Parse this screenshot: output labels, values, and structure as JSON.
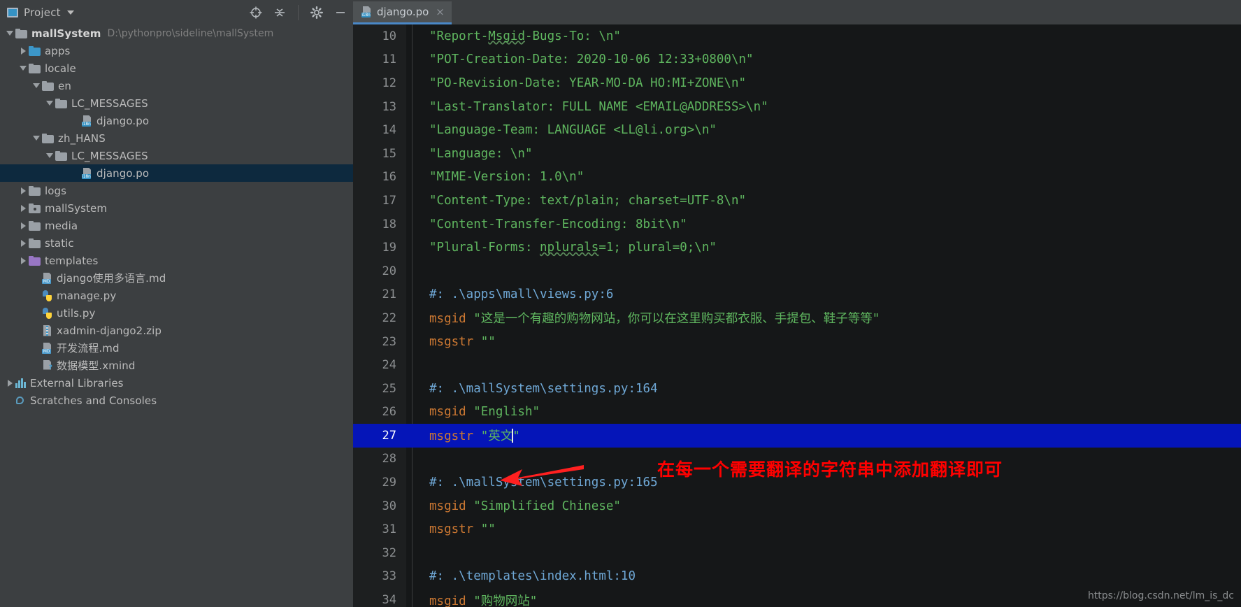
{
  "window": {
    "project_label": "Project",
    "toolbar_icons": [
      "target-icon",
      "collapse-all-icon",
      "gear-icon",
      "minimize-icon"
    ]
  },
  "tab": {
    "title": "django.po",
    "close_label": "×",
    "icon": "i18n-file-icon",
    "badge": "i18n"
  },
  "sidebar": {
    "items": [
      {
        "label": "mallSystem",
        "path": "D:\\pythonpro\\sideline\\mallSystem",
        "indent": 0,
        "arrow": "open",
        "icon": "folder",
        "bold": true
      },
      {
        "label": "apps",
        "path": "",
        "indent": 1,
        "arrow": "closed",
        "icon": "folder-blue",
        "bold": false
      },
      {
        "label": "locale",
        "path": "",
        "indent": 1,
        "arrow": "open",
        "icon": "folder",
        "bold": false
      },
      {
        "label": "en",
        "path": "",
        "indent": 2,
        "arrow": "open",
        "icon": "folder",
        "bold": false
      },
      {
        "label": "LC_MESSAGES",
        "path": "",
        "indent": 3,
        "arrow": "open",
        "icon": "folder",
        "bold": false
      },
      {
        "label": "django.po",
        "path": "",
        "indent": 5,
        "arrow": "none",
        "icon": "i18n-file",
        "bold": false
      },
      {
        "label": "zh_HANS",
        "path": "",
        "indent": 2,
        "arrow": "open",
        "icon": "folder",
        "bold": false
      },
      {
        "label": "LC_MESSAGES",
        "path": "",
        "indent": 3,
        "arrow": "open",
        "icon": "folder",
        "bold": false
      },
      {
        "label": "django.po",
        "path": "",
        "indent": 5,
        "arrow": "none",
        "icon": "i18n-file",
        "bold": false,
        "selected": true
      },
      {
        "label": "logs",
        "path": "",
        "indent": 1,
        "arrow": "closed",
        "icon": "folder",
        "bold": false
      },
      {
        "label": "mallSystem",
        "path": "",
        "indent": 1,
        "arrow": "closed",
        "icon": "folder-module",
        "bold": false
      },
      {
        "label": "media",
        "path": "",
        "indent": 1,
        "arrow": "closed",
        "icon": "folder",
        "bold": false
      },
      {
        "label": "static",
        "path": "",
        "indent": 1,
        "arrow": "closed",
        "icon": "folder",
        "bold": false
      },
      {
        "label": "templates",
        "path": "",
        "indent": 1,
        "arrow": "closed",
        "icon": "folder-purple",
        "bold": false
      },
      {
        "label": "django使用多语言.md",
        "path": "",
        "indent": 2,
        "arrow": "none",
        "icon": "md-file",
        "bold": false
      },
      {
        "label": "manage.py",
        "path": "",
        "indent": 2,
        "arrow": "none",
        "icon": "python-file",
        "bold": false
      },
      {
        "label": "utils.py",
        "path": "",
        "indent": 2,
        "arrow": "none",
        "icon": "python-file",
        "bold": false
      },
      {
        "label": "xadmin-django2.zip",
        "path": "",
        "indent": 2,
        "arrow": "none",
        "icon": "zip-file",
        "bold": false
      },
      {
        "label": "开发流程.md",
        "path": "",
        "indent": 2,
        "arrow": "none",
        "icon": "md-file",
        "bold": false
      },
      {
        "label": "数据模型.xmind",
        "path": "",
        "indent": 2,
        "arrow": "none",
        "icon": "xmind-file",
        "bold": false
      },
      {
        "label": "External Libraries",
        "path": "",
        "indent": 0,
        "arrow": "closed",
        "icon": "library",
        "bold": false
      },
      {
        "label": "Scratches and Consoles",
        "path": "",
        "indent": 0,
        "arrow": "none",
        "icon": "scratches",
        "bold": false
      }
    ]
  },
  "editor": {
    "lines": [
      {
        "n": "10",
        "tokens": [
          {
            "t": "\"Report-",
            "c": "str"
          },
          {
            "t": "Msgid",
            "c": "str-wavy"
          },
          {
            "t": "-Bugs-To: \\n\"",
            "c": "str"
          }
        ]
      },
      {
        "n": "11",
        "tokens": [
          {
            "t": "\"POT-Creation-Date: 2020-10-06 12:33+0800\\n\"",
            "c": "str"
          }
        ]
      },
      {
        "n": "12",
        "tokens": [
          {
            "t": "\"PO-Revision-Date: YEAR-MO-DA HO:MI+ZONE\\n\"",
            "c": "str"
          }
        ]
      },
      {
        "n": "13",
        "tokens": [
          {
            "t": "\"Last-Translator: FULL NAME <EMAIL@ADDRESS>\\n\"",
            "c": "str"
          }
        ]
      },
      {
        "n": "14",
        "tokens": [
          {
            "t": "\"Language-Team: LANGUAGE <LL@li.org>\\n\"",
            "c": "str"
          }
        ]
      },
      {
        "n": "15",
        "tokens": [
          {
            "t": "\"Language: \\n\"",
            "c": "str"
          }
        ]
      },
      {
        "n": "16",
        "tokens": [
          {
            "t": "\"MIME-Version: 1.0\\n\"",
            "c": "str"
          }
        ]
      },
      {
        "n": "17",
        "tokens": [
          {
            "t": "\"Content-Type: text/plain; charset=UTF-8\\n\"",
            "c": "str"
          }
        ]
      },
      {
        "n": "18",
        "tokens": [
          {
            "t": "\"Content-Transfer-Encoding: 8bit\\n\"",
            "c": "str"
          }
        ]
      },
      {
        "n": "19",
        "tokens": [
          {
            "t": "\"Plural-Forms: ",
            "c": "str"
          },
          {
            "t": "nplurals",
            "c": "str-wavy"
          },
          {
            "t": "=1; plural=0;\\n\"",
            "c": "str"
          }
        ]
      },
      {
        "n": "20",
        "tokens": []
      },
      {
        "n": "21",
        "tokens": [
          {
            "t": "#: .\\apps\\mall\\views.py:6",
            "c": "cmt"
          }
        ]
      },
      {
        "n": "22",
        "tokens": [
          {
            "t": "msgid ",
            "c": "kw"
          },
          {
            "t": "\"这是一个有趣的购物网站，你可以在这里购买都衣服、手提包、鞋子等等\"",
            "c": "str"
          }
        ]
      },
      {
        "n": "23",
        "tokens": [
          {
            "t": "msgstr ",
            "c": "kw"
          },
          {
            "t": "\"\"",
            "c": "str"
          }
        ]
      },
      {
        "n": "24",
        "tokens": []
      },
      {
        "n": "25",
        "tokens": [
          {
            "t": "#: .\\mallSystem\\settings.py:164",
            "c": "cmt"
          }
        ]
      },
      {
        "n": "26",
        "tokens": [
          {
            "t": "msgid ",
            "c": "kw"
          },
          {
            "t": "\"English\"",
            "c": "str"
          }
        ]
      },
      {
        "n": "27",
        "tokens": [
          {
            "t": "msgstr ",
            "c": "kw"
          },
          {
            "t": "\"英文",
            "c": "str"
          },
          {
            "t": "",
            "c": "caret"
          },
          {
            "t": "\"",
            "c": "str"
          }
        ],
        "highlight": true
      },
      {
        "n": "28",
        "tokens": []
      },
      {
        "n": "29",
        "tokens": [
          {
            "t": "#: .\\mallSystem\\settings.py:165",
            "c": "cmt"
          }
        ]
      },
      {
        "n": "30",
        "tokens": [
          {
            "t": "msgid ",
            "c": "kw"
          },
          {
            "t": "\"Simplified Chinese\"",
            "c": "str"
          }
        ]
      },
      {
        "n": "31",
        "tokens": [
          {
            "t": "msgstr ",
            "c": "kw"
          },
          {
            "t": "\"\"",
            "c": "str"
          }
        ]
      },
      {
        "n": "32",
        "tokens": []
      },
      {
        "n": "33",
        "tokens": [
          {
            "t": "#: .\\templates\\index.html:10",
            "c": "cmt"
          }
        ]
      },
      {
        "n": "34",
        "tokens": [
          {
            "t": "msgid ",
            "c": "kw"
          },
          {
            "t": "\"购物网站\"",
            "c": "str"
          }
        ]
      }
    ]
  },
  "annotation": {
    "text": "在每一个需要翻译的字符串中添加翻译即可",
    "color": "#ff0000"
  },
  "watermark": {
    "text": "https://blog.csdn.net/lm_is_dc"
  },
  "colors": {
    "selection_blue": "#0515b8",
    "sidebar_selected": "#0d293e",
    "tab_underline": "#4a88c7",
    "string_green": "#5fb65f",
    "keyword_orange": "#cc7832",
    "comment_blue": "#6fa8d6"
  }
}
